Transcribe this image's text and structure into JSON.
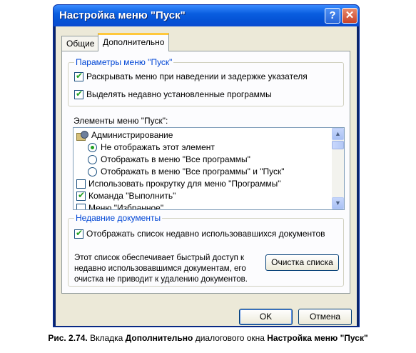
{
  "window": {
    "title": "Настройка меню \"Пуск\"",
    "help_icon": "?",
    "close_icon": "✕"
  },
  "tabs": [
    {
      "label": "Общие",
      "selected": false
    },
    {
      "label": "Дополнительно",
      "selected": true
    }
  ],
  "start_menu_params": {
    "legend": "Параметры меню \"Пуск\"",
    "options": [
      {
        "label": "Раскрывать меню при наведении и задержке указателя",
        "checked": true
      },
      {
        "label": "Выделять недавно установленные программы",
        "checked": true
      }
    ]
  },
  "menu_items": {
    "label": "Элементы меню \"Пуск\":",
    "items": [
      {
        "kind": "header",
        "icon": "admin-tools-icon",
        "label": "Администрирование"
      },
      {
        "kind": "radio",
        "label": "Не отображать этот элемент",
        "checked": true
      },
      {
        "kind": "radio",
        "label": "Отображать в меню \"Все программы\"",
        "checked": false
      },
      {
        "kind": "radio",
        "label": "Отображать в меню \"Все программы\" и \"Пуск\"",
        "checked": false
      },
      {
        "kind": "checkbox",
        "label": "Использовать прокрутку для меню \"Программы\"",
        "checked": false
      },
      {
        "kind": "checkbox",
        "label": "Команда \"Выполнить\"",
        "checked": true
      },
      {
        "kind": "checkbox",
        "label": "Меню \"Избранное\"",
        "checked": false
      }
    ],
    "scroll_up": "▲",
    "scroll_down": "▼"
  },
  "recent_docs": {
    "legend": "Недавние документы",
    "option": {
      "label": "Отображать список недавно использовавшихся документов",
      "checked": true
    },
    "description_lines": [
      "Этот список обеспечивает быстрый доступ к",
      "недавно использовавшимся документам, его",
      "очистка не приводит к удалению документов."
    ],
    "clear_button": "Очистка списка"
  },
  "buttons": {
    "ok": "OK",
    "cancel": "Отмена"
  },
  "caption": {
    "prefix": "Рис. 2.74.",
    "text1": " Вкладка ",
    "tab_name": "Дополнительно",
    "text2": " диалогового окна ",
    "dialog_name": "Настройка меню \"Пуск\""
  }
}
